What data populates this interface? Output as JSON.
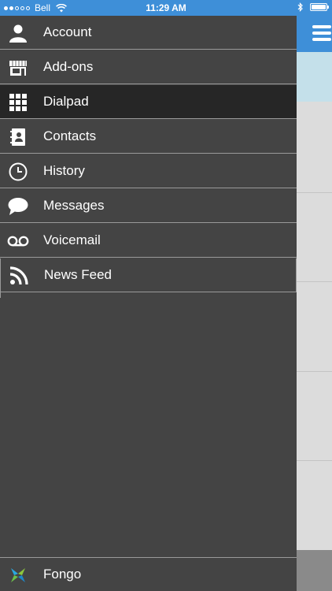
{
  "status_bar": {
    "carrier": "Bell",
    "time": "11:29 AM",
    "signal_bars": 2,
    "signal_total": 5,
    "battery_level": 1.0
  },
  "drawer": {
    "items": [
      {
        "label": "Account",
        "icon": "person-icon"
      },
      {
        "label": "Add-ons",
        "icon": "store-icon"
      },
      {
        "label": "Dialpad",
        "icon": "dialpad-icon",
        "active": true
      },
      {
        "label": "Contacts",
        "icon": "contacts-book-icon"
      },
      {
        "label": "History",
        "icon": "clock-icon"
      },
      {
        "label": "Messages",
        "icon": "speech-bubble-icon"
      },
      {
        "label": "Voicemail",
        "icon": "voicemail-icon"
      },
      {
        "label": "News Feed",
        "icon": "rss-icon"
      }
    ],
    "footer": {
      "label": "Fongo",
      "icon": "fongo-logo-icon"
    }
  },
  "colors": {
    "accent": "#3e8fd8",
    "drawer_bg": "#444444",
    "active_bg": "#262626",
    "divider": "#9a9a9a",
    "peek_highlight": "#c4e0ea"
  }
}
